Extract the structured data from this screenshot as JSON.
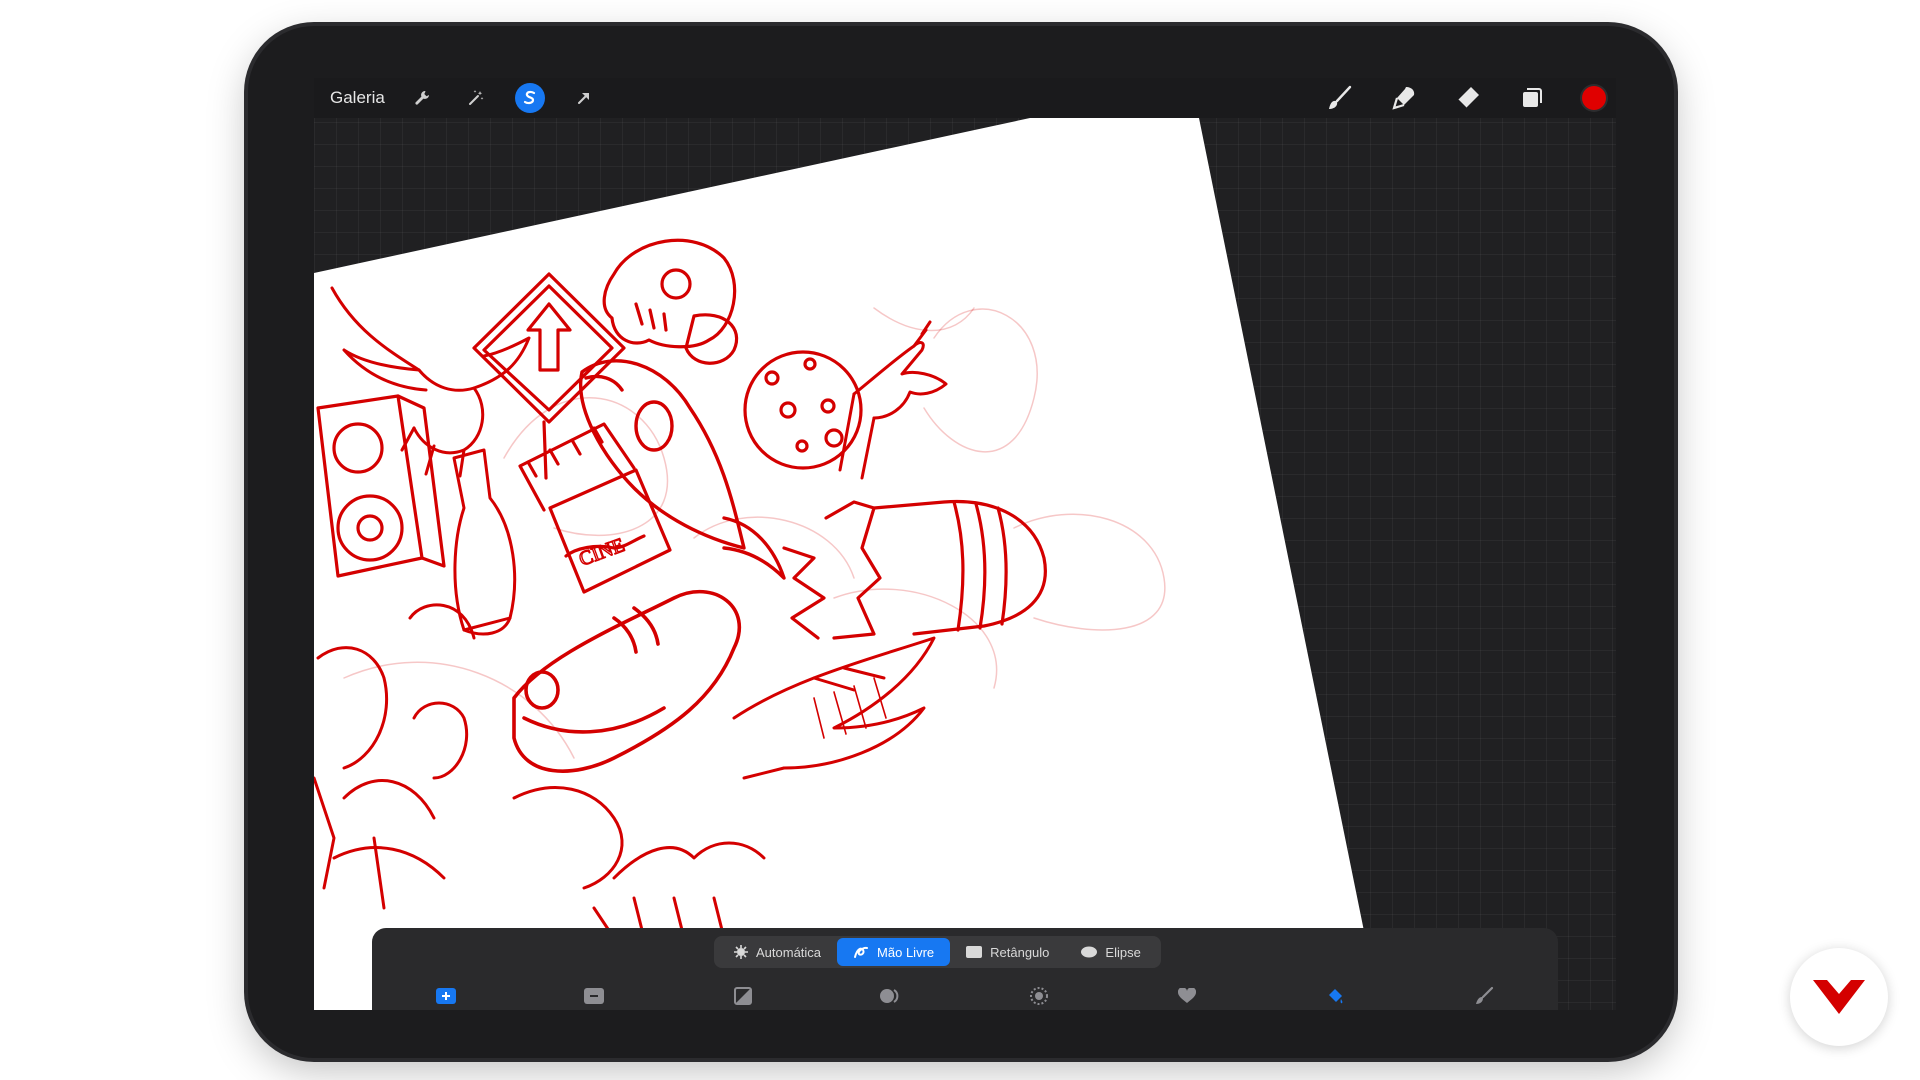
{
  "colors": {
    "accent": "#1778f2",
    "current_color": "#e00000",
    "sketch_red": "#d40000"
  },
  "toolbar": {
    "gallery_label": "Galeria",
    "left_icons": [
      "wrench-icon",
      "magic-wand-icon",
      "selection-s-icon",
      "arrow-transform-icon"
    ],
    "right_icons": [
      "brush-icon",
      "smudge-icon",
      "eraser-icon",
      "layers-icon"
    ]
  },
  "selection_modes": [
    {
      "label": "Automática",
      "icon": "auto-gear-icon",
      "active": false
    },
    {
      "label": "Mão Livre",
      "icon": "freehand-icon",
      "active": true
    },
    {
      "label": "Retângulo",
      "icon": "rectangle-icon",
      "active": false
    },
    {
      "label": "Elipse",
      "icon": "ellipse-icon",
      "active": false
    }
  ],
  "selection_tools": [
    "add-icon",
    "subtract-icon",
    "invert-icon",
    "copy-paste-icon",
    "feather-icon",
    "save-selection-icon",
    "color-fill-icon",
    "clear-icon"
  ]
}
